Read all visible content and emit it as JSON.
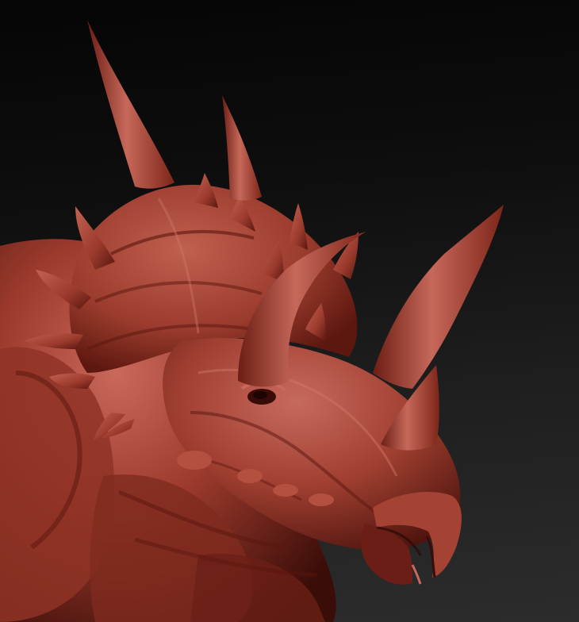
{
  "scene": {
    "subject": "",
    "colors": {
      "background_top": "#050505",
      "background_bottom": "#2c2c2c",
      "clay_highlight": "#c9695c",
      "clay_mid": "#9c3a2d",
      "clay_dark": "#4a120c",
      "clay_deep": "#2a0805"
    }
  }
}
